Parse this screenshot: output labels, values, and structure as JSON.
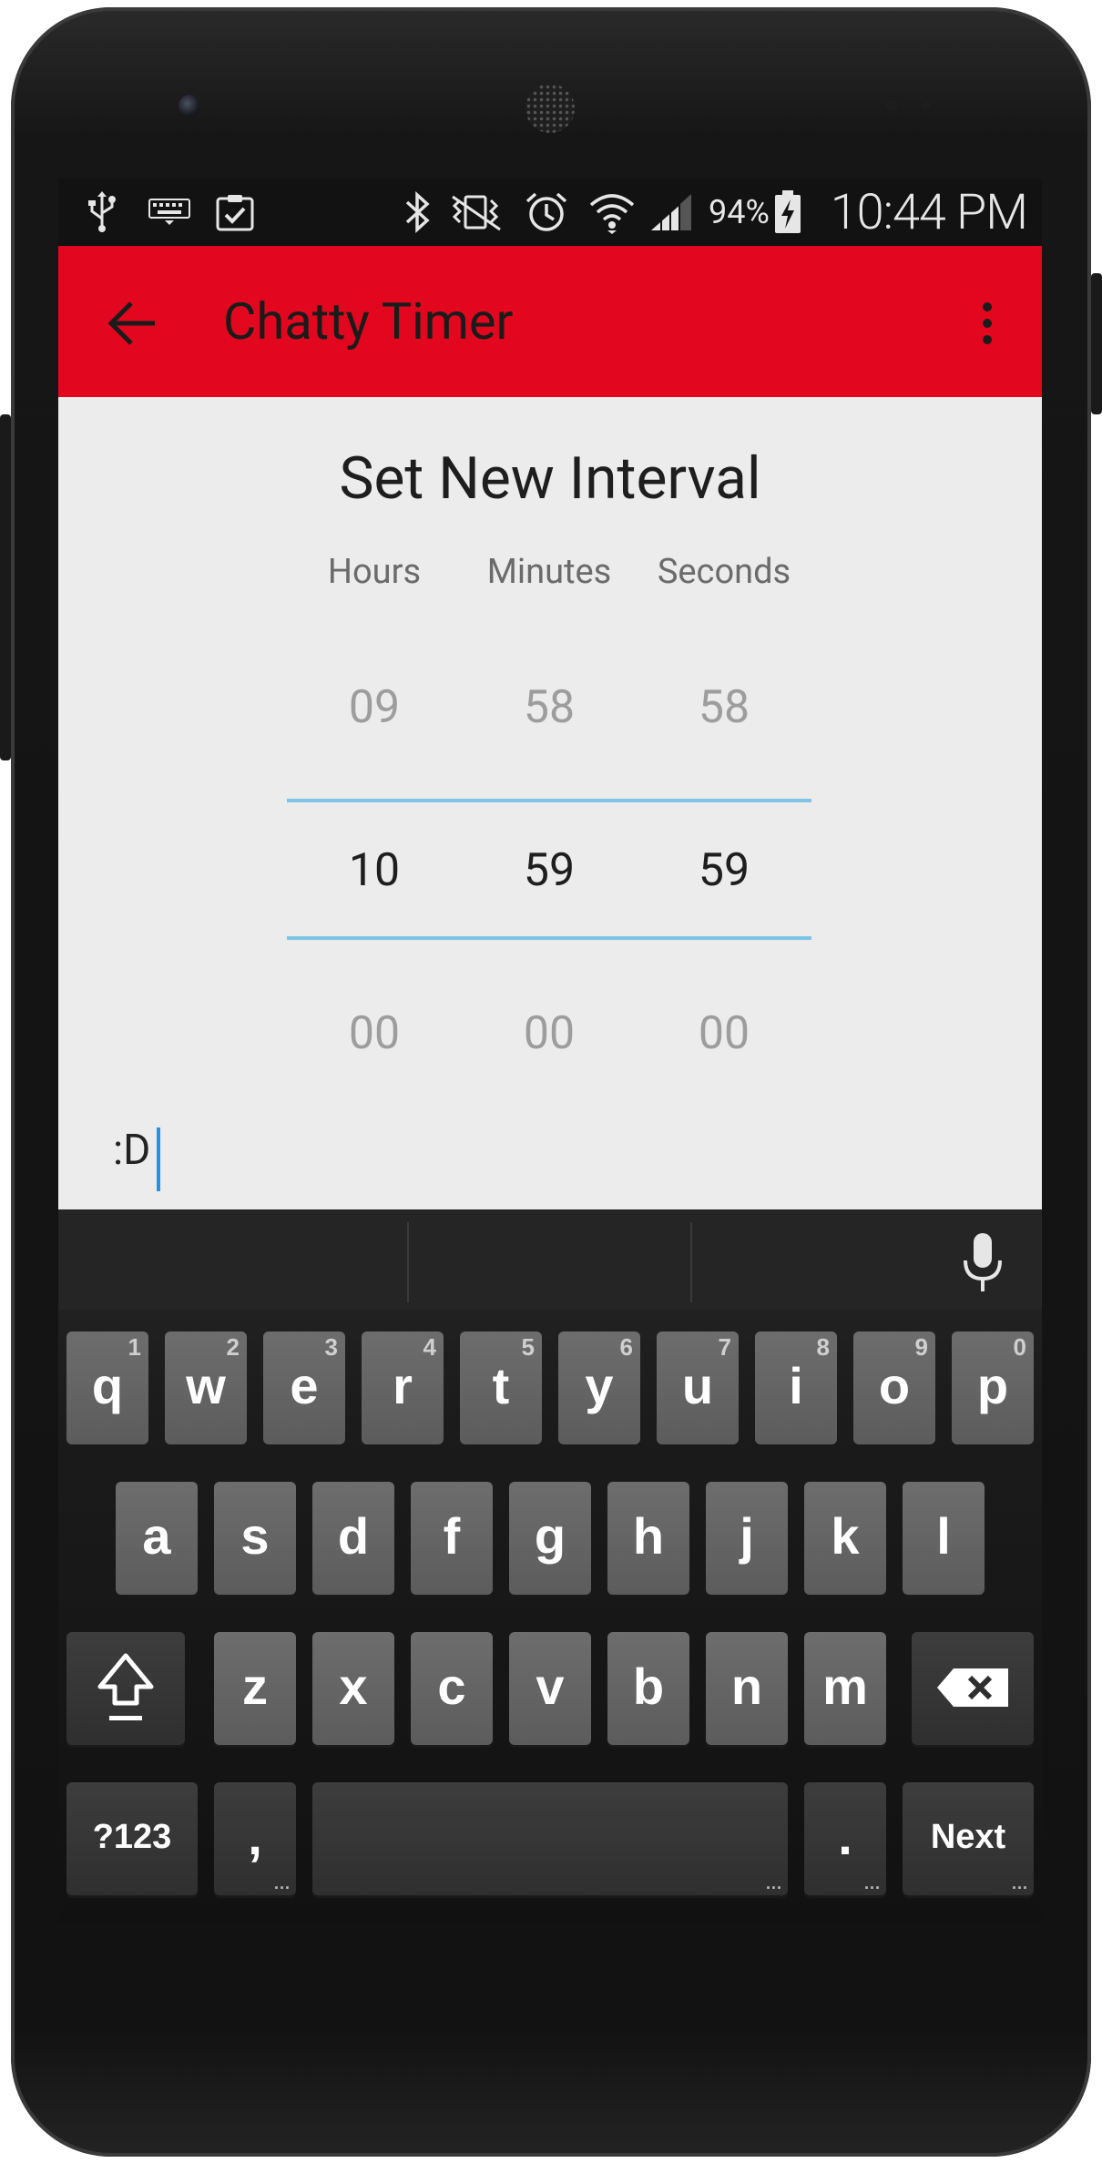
{
  "status_bar": {
    "battery_percent": "94%",
    "time": "10:44 PM",
    "icons": [
      "usb-icon",
      "keyboard-icon",
      "clipboard-check-icon",
      "bluetooth-icon",
      "vibrate-mute-icon",
      "alarm-icon",
      "wifi-icon",
      "signal-icon",
      "battery-charging-icon"
    ]
  },
  "toolbar": {
    "title": "Chatty Timer",
    "color": "#e2071e"
  },
  "picker": {
    "heading": "Set New Interval",
    "columns": [
      "Hours",
      "Minutes",
      "Seconds"
    ],
    "previous": [
      "09",
      "58",
      "58"
    ],
    "selected": [
      "10",
      "59",
      "59"
    ],
    "next": [
      "00",
      "00",
      "00"
    ],
    "divider_color": "#7fc4e4"
  },
  "text_field": {
    "value": ":D"
  },
  "keyboard": {
    "row1": [
      {
        "label": "q",
        "hint": "1"
      },
      {
        "label": "w",
        "hint": "2"
      },
      {
        "label": "e",
        "hint": "3"
      },
      {
        "label": "r",
        "hint": "4"
      },
      {
        "label": "t",
        "hint": "5"
      },
      {
        "label": "y",
        "hint": "6"
      },
      {
        "label": "u",
        "hint": "7"
      },
      {
        "label": "i",
        "hint": "8"
      },
      {
        "label": "o",
        "hint": "9"
      },
      {
        "label": "p",
        "hint": "0"
      }
    ],
    "row2": [
      "a",
      "s",
      "d",
      "f",
      "g",
      "h",
      "j",
      "k",
      "l"
    ],
    "row3": [
      "z",
      "x",
      "c",
      "v",
      "b",
      "n",
      "m"
    ],
    "symbols_label": "?123",
    "comma_label": ",",
    "period_label": ".",
    "action_label": "Next"
  }
}
